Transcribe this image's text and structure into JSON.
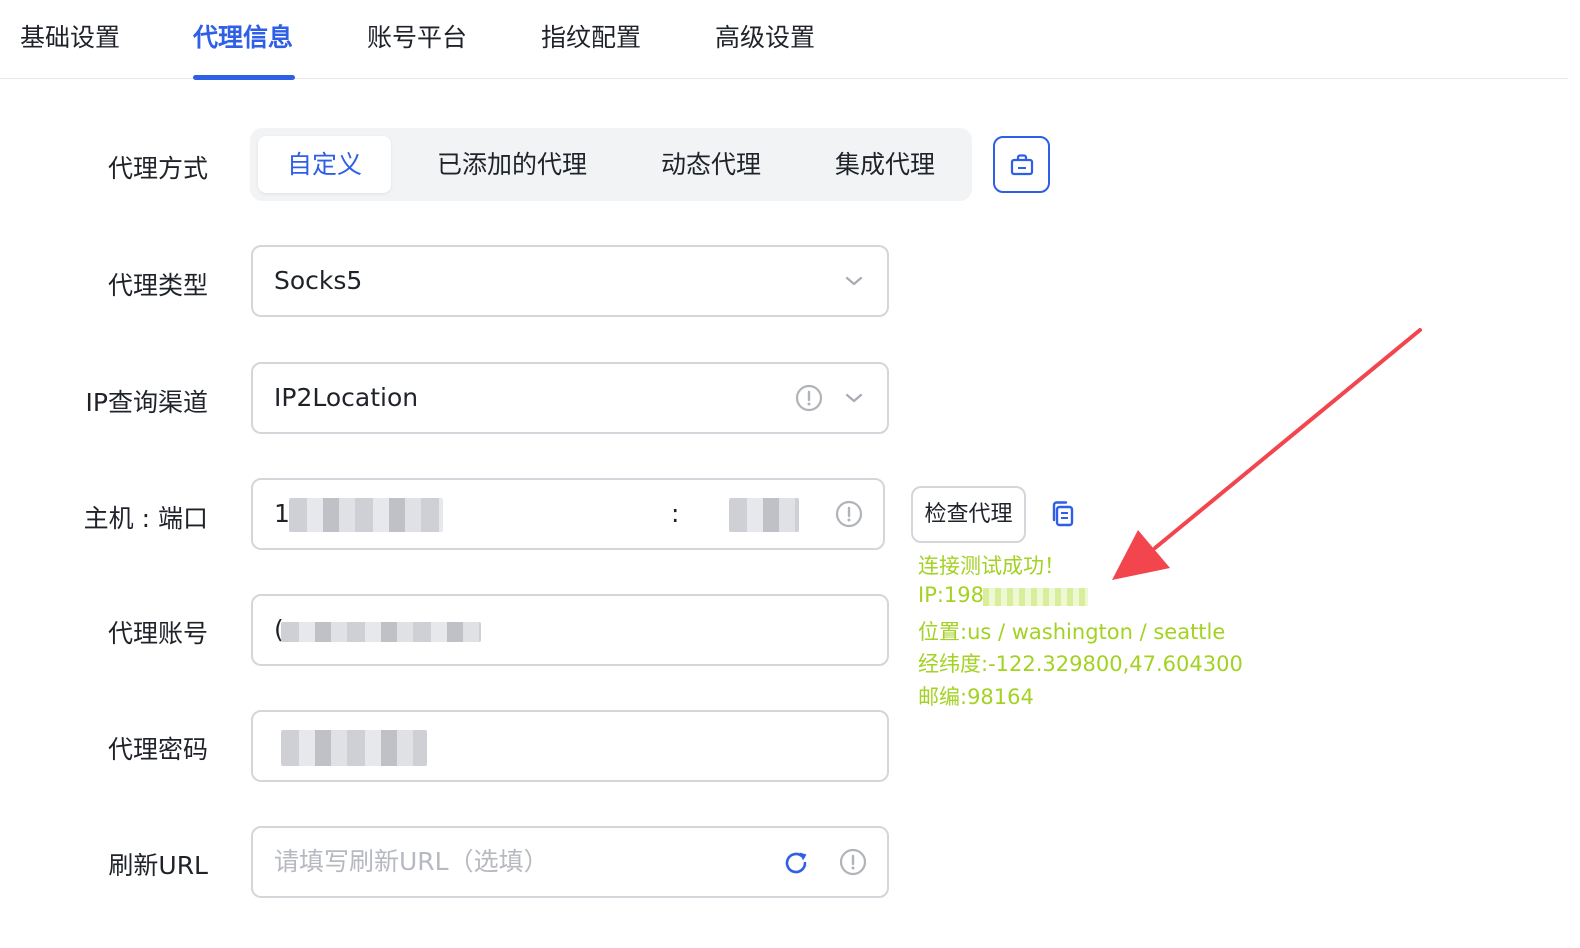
{
  "tabs": [
    {
      "label": "基础设置",
      "active": false
    },
    {
      "label": "代理信息",
      "active": true
    },
    {
      "label": "账号平台",
      "active": false
    },
    {
      "label": "指纹配置",
      "active": false
    },
    {
      "label": "高级设置",
      "active": false
    }
  ],
  "proxy_method": {
    "label": "代理方式",
    "options": [
      "自定义",
      "已添加的代理",
      "动态代理",
      "集成代理"
    ],
    "selected": "自定义"
  },
  "proxy_type": {
    "label": "代理类型",
    "value": "Socks5"
  },
  "ip_channel": {
    "label": "IP查询渠道",
    "value": "IP2Location"
  },
  "host_port": {
    "label": "主机 : 端口",
    "host_visible": "1",
    "separator": ":"
  },
  "proxy_account": {
    "label": "代理账号",
    "value_visible": "("
  },
  "proxy_password": {
    "label": "代理密码"
  },
  "refresh_url": {
    "label": "刷新URL",
    "placeholder": "请填写刷新URL（选填）"
  },
  "check_button": {
    "label": "检查代理"
  },
  "result": {
    "status": "连接测试成功！",
    "ip": "IP:198.",
    "location": "位置:us / washington / seattle",
    "coords": "经纬度:-122.329800,47.604300",
    "postcode": "邮编:98164"
  },
  "colors": {
    "accent": "#2f5fe6",
    "success": "#a3d223",
    "arrow": "#f2454e"
  }
}
